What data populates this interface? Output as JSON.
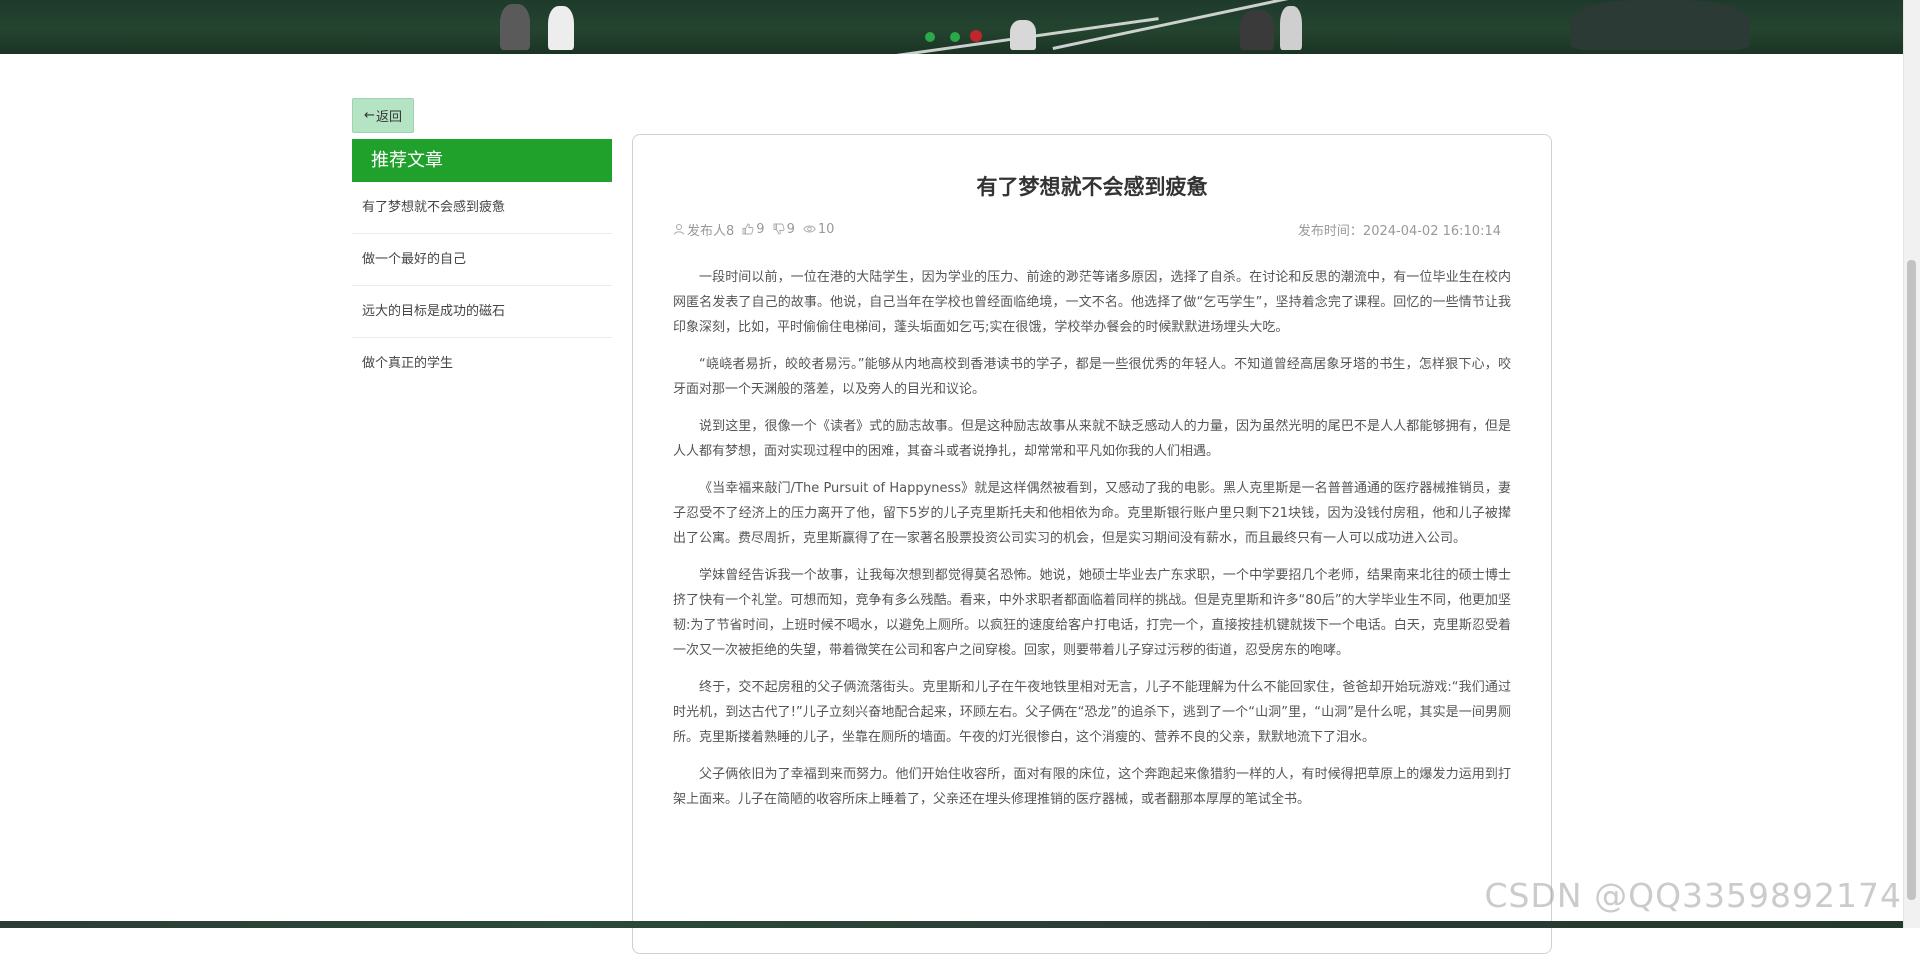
{
  "back_button": {
    "arrow": "←",
    "label": "返回"
  },
  "sidebar": {
    "title": "推荐文章",
    "items": [
      "有了梦想就不会感到疲惫",
      "做一个最好的自己",
      "远大的目标是成功的磁石",
      "做个真正的学生"
    ]
  },
  "article": {
    "title": "有了梦想就不会感到疲惫",
    "publisher": "发布人8",
    "likes": "9",
    "dislikes": "9",
    "views": "10",
    "publish_label": "发布时间：",
    "publish_time": "2024-04-02 16:10:14",
    "paragraphs": [
      "一段时间以前，一位在港的大陆学生，因为学业的压力、前途的渺茫等诸多原因，选择了自杀。在讨论和反思的潮流中，有一位毕业生在校内网匿名发表了自己的故事。他说，自己当年在学校也曾经面临绝境，一文不名。他选择了做“乞丐学生”，坚持着念完了课程。回忆的一些情节让我印象深刻，比如，平时偷偷住电梯间，蓬头垢面如乞丐;实在很饿，学校举办餐会的时候默默进场埋头大吃。",
      "“峣峣者易折，皎皎者易污。”能够从内地高校到香港读书的学子，都是一些很优秀的年轻人。不知道曾经高居象牙塔的书生，怎样狠下心，咬牙面对那一个天渊般的落差，以及旁人的目光和议论。",
      "说到这里，很像一个《读者》式的励志故事。但是这种励志故事从来就不缺乏感动人的力量，因为虽然光明的尾巴不是人人都能够拥有，但是人人都有梦想，面对实现过程中的困难，其奋斗或者说挣扎，却常常和平凡如你我的人们相遇。",
      "《当幸福来敲门/The Pursuit of Happyness》就是这样偶然被看到，又感动了我的电影。黑人克里斯是一名普普通通的医疗器械推销员，妻子忍受不了经济上的压力离开了他，留下5岁的儿子克里斯托夫和他相依为命。克里斯银行账户里只剩下21块钱，因为没钱付房租，他和儿子被撵出了公寓。费尽周折，克里斯赢得了在一家著名股票投资公司实习的机会，但是实习期间没有薪水，而且最终只有一人可以成功进入公司。",
      "学妹曾经告诉我一个故事，让我每次想到都觉得莫名恐怖。她说，她硕士毕业去广东求职，一个中学要招几个老师，结果南来北往的硕士博士挤了快有一个礼堂。可想而知，竞争有多么残酷。看来，中外求职者都面临着同样的挑战。但是克里斯和许多“80后”的大学毕业生不同，他更加坚韧:为了节省时间，上班时候不喝水，以避免上厕所。以疯狂的速度给客户打电话，打完一个，直接按挂机键就拨下一个电话。白天，克里斯忍受着一次又一次被拒绝的失望，带着微笑在公司和客户之间穿梭。回家，则要带着儿子穿过污秽的街道，忍受房东的咆哮。",
      "终于，交不起房租的父子俩流落街头。克里斯和儿子在午夜地铁里相对无言，儿子不能理解为什么不能回家住，爸爸却开始玩游戏:“我们通过时光机，到达古代了!”儿子立刻兴奋地配合起来，环顾左右。父子俩在“恐龙”的追杀下，逃到了一个“山洞”里，“山洞”是什么呢，其实是一间男厕所。克里斯搂着熟睡的儿子，坐靠在厕所的墙面。午夜的灯光很惨白，这个消瘦的、营养不良的父亲，默默地流下了泪水。",
      "父子俩依旧为了幸福到来而努力。他们开始住收容所，面对有限的床位，这个奔跑起来像猎豹一样的人，有时候得把草原上的爆发力运用到打架上面来。儿子在简陋的收容所床上睡着了，父亲还在埋头修理推销的医疗器械，或者翻那本厚厚的笔试全书。"
    ]
  },
  "watermark": "CSDN @QQ3359892174",
  "icons": {
    "user": "user-icon",
    "like": "thumbs-up-icon",
    "dislike": "thumbs-down-icon",
    "views": "eye-icon"
  },
  "colors": {
    "accent_green": "#20a12b",
    "back_button_bg": "#b5e4c4"
  }
}
